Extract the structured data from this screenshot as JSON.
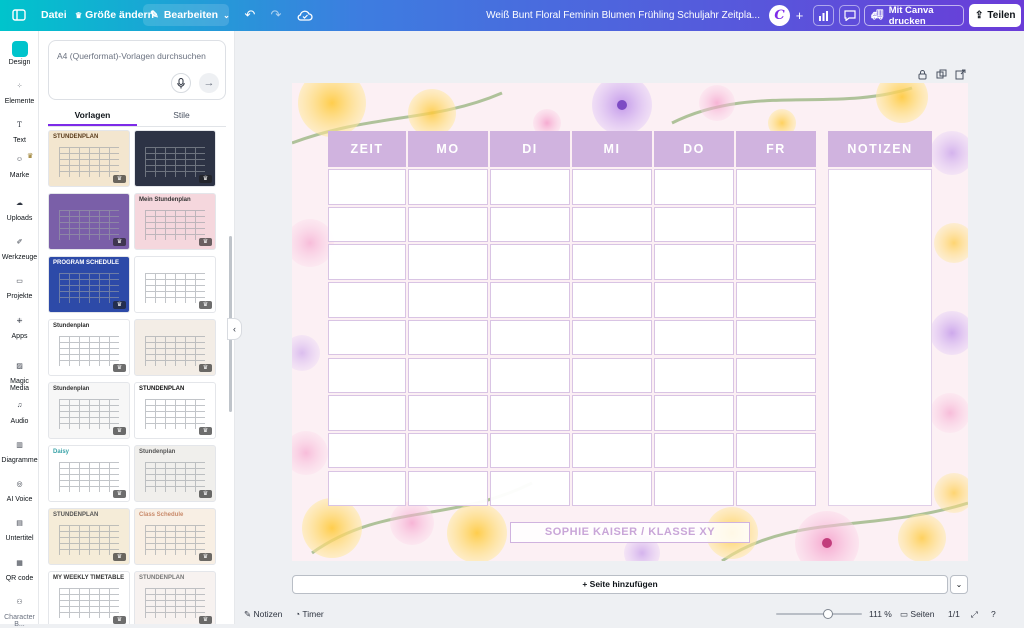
{
  "topbar": {
    "file_label": "Datei",
    "resize_label": "Größe ändern",
    "edit_label": "Bearbeiten",
    "doc_title": "Weiß Bunt Floral Feminin Blumen Frühling Schuljahr Zeitpla...",
    "avatar_letter": "C",
    "print_label": "Mit Canva drucken",
    "share_label": "Teilen"
  },
  "rail": {
    "items": [
      "Design",
      "Elemente",
      "Text",
      "Marke",
      "Uploads",
      "Werkzeuge",
      "Projekte",
      "Apps",
      "Magic Media",
      "Audio",
      "Diagramme",
      "AI Voice",
      "Untertitel",
      "QR code",
      "Character B..."
    ]
  },
  "panel": {
    "search_placeholder": "A4 (Querformat)-Vorlagen durchsuchen",
    "tabs": [
      "Vorlagen",
      "Stile"
    ],
    "thumb_titles": [
      "STUNDENPLAN",
      "",
      "",
      "Mein Stundenplan",
      "PROGRAM SCHEDULE",
      "",
      "Stundenplan",
      "",
      "Stundenplan",
      "STUNDENPLAN",
      "Daisy",
      "Stundenplan",
      "STUNDENPLAN",
      "Class Schedule",
      "MY WEEKLY TIMETABLE",
      "STUNDENPLAN"
    ]
  },
  "design": {
    "headers": [
      "ZEIT",
      "MO",
      "DI",
      "MI",
      "DO",
      "FR"
    ],
    "notes_header": "NOTIZEN",
    "footer": "SOPHIE KAISER / KLASSE XY",
    "row_count": 9
  },
  "bottom": {
    "add_page": "+ Seite hinzufügen",
    "notes": "Notizen",
    "timer": "Timer",
    "zoom": "111 %",
    "pages_label": "Seiten",
    "page_count": "1/1"
  },
  "colors": {
    "accent": "#7d2ae8",
    "header_lilac": "#d0b3df"
  }
}
